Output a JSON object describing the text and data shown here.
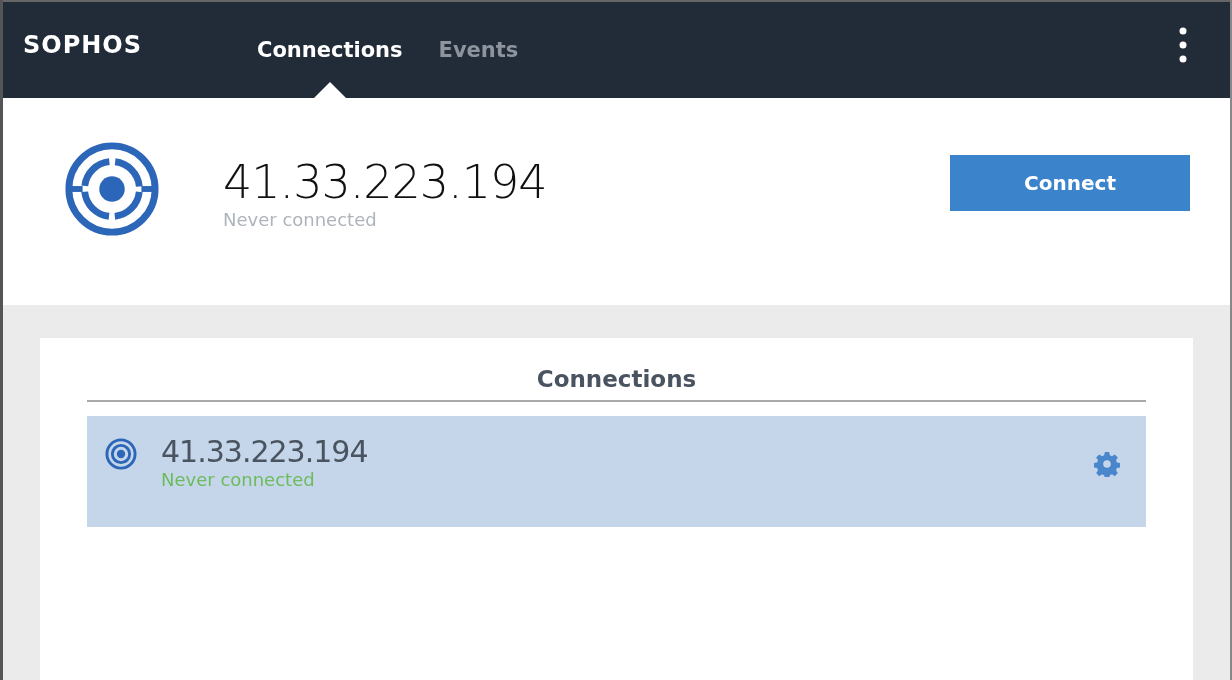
{
  "header": {
    "logo": "SOPHOS",
    "tabs": [
      {
        "label": "Connections",
        "selected": true
      },
      {
        "label": "Events",
        "selected": false
      }
    ]
  },
  "current": {
    "address": "41.33.223.194",
    "status": "Never connected",
    "button": "Connect"
  },
  "connections": {
    "title": "Connections",
    "items": [
      {
        "address": "41.33.223.194",
        "status": "Never connected",
        "selected": true
      }
    ]
  }
}
